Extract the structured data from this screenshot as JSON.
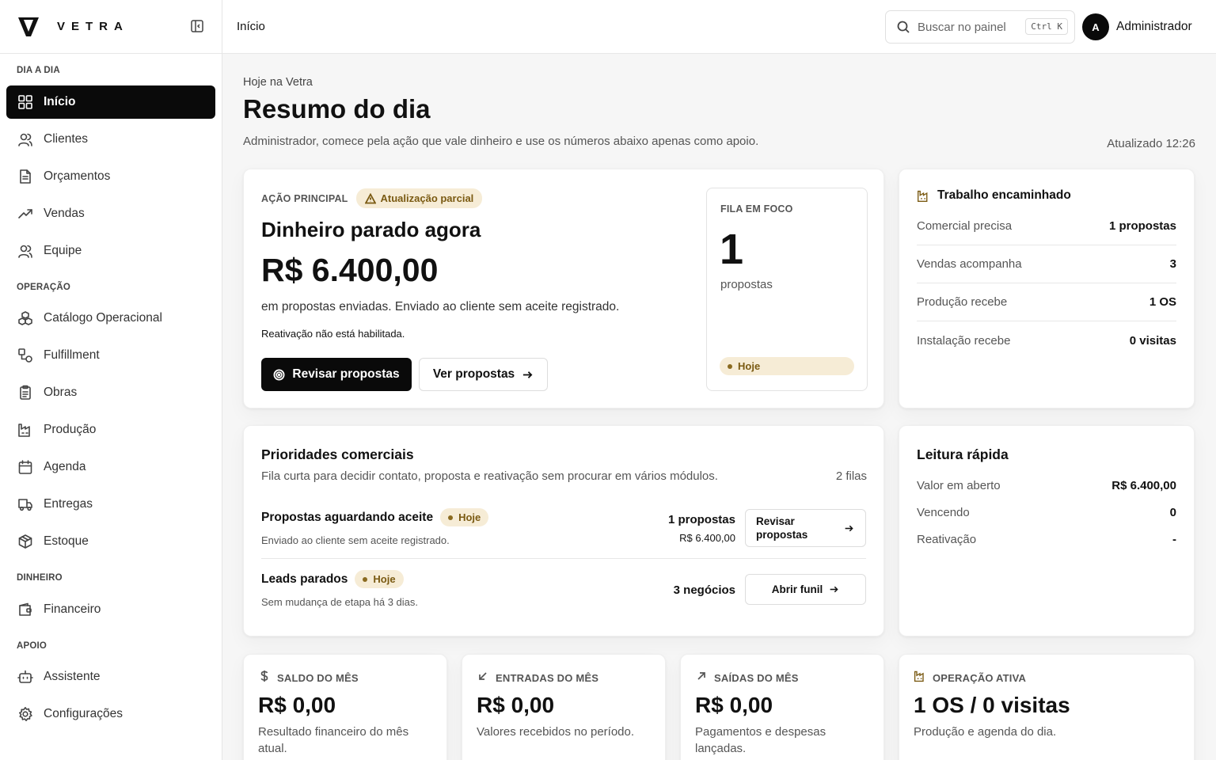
{
  "app": {
    "brand": "VETRA"
  },
  "sidebar": {
    "sections": [
      {
        "label": "DIA A DIA"
      },
      {
        "label": "OPERAÇÃO"
      },
      {
        "label": "DINHEIRO"
      },
      {
        "label": "APOIO"
      }
    ],
    "items": [
      {
        "label": "Início",
        "icon": "grid-icon",
        "active": true
      },
      {
        "label": "Clientes",
        "icon": "users-icon"
      },
      {
        "label": "Orçamentos",
        "icon": "document-icon"
      },
      {
        "label": "Vendas",
        "icon": "trending-up-icon"
      },
      {
        "label": "Equipe",
        "icon": "team-icon"
      },
      {
        "label": "Catálogo Operacional",
        "icon": "boxes-icon"
      },
      {
        "label": "Fulfillment",
        "icon": "shapes-icon"
      },
      {
        "label": "Obras",
        "icon": "clipboard-icon"
      },
      {
        "label": "Produção",
        "icon": "factory-icon"
      },
      {
        "label": "Agenda",
        "icon": "calendar-icon"
      },
      {
        "label": "Entregas",
        "icon": "truck-icon"
      },
      {
        "label": "Estoque",
        "icon": "package-icon"
      },
      {
        "label": "Financeiro",
        "icon": "wallet-icon"
      },
      {
        "label": "Assistente",
        "icon": "bot-icon"
      },
      {
        "label": "Configurações",
        "icon": "gear-icon"
      }
    ]
  },
  "header": {
    "title": "Início",
    "search_placeholder": "Buscar no painel",
    "shortcut": "Ctrl K",
    "avatar_initial": "A",
    "user_name": "Administrador"
  },
  "page": {
    "kicker": "Hoje na Vetra",
    "title": "Resumo do dia",
    "subtitle": "Administrador, comece pela ação que vale dinheiro e use os números abaixo apenas como apoio.",
    "updated": "Atualizado 12:26"
  },
  "action": {
    "caption": "AÇÃO PRINCIPAL",
    "badge": "Atualização parcial",
    "heading": "Dinheiro parado agora",
    "amount": "R$ 6.400,00",
    "description": "em propostas enviadas. Enviado ao cliente sem aceite registrado.",
    "note": "Reativação não está habilitada.",
    "primary_button": "Revisar propostas",
    "secondary_button": "Ver propostas",
    "focus": {
      "caption": "FILA EM FOCO",
      "number": "1",
      "unit": "propostas",
      "badge": "Hoje"
    }
  },
  "routed": {
    "title": "Trabalho encaminhado",
    "rows": [
      {
        "label": "Comercial precisa",
        "value": "1 propostas"
      },
      {
        "label": "Vendas acompanha",
        "value": "3"
      },
      {
        "label": "Produção recebe",
        "value": "1 OS"
      },
      {
        "label": "Instalação recebe",
        "value": "0 visitas"
      }
    ]
  },
  "priorities": {
    "title": "Prioridades comerciais",
    "subtitle": "Fila curta para decidir contato, proposta e reativação sem procurar em vários módulos.",
    "count": "2 filas",
    "items": [
      {
        "title": "Propostas aguardando aceite",
        "badge": "Hoje",
        "desc": "Enviado ao cliente sem aceite registrado.",
        "metric": "1 propostas",
        "metric_sub": "R$ 6.400,00",
        "button": "Revisar propostas"
      },
      {
        "title": "Leads parados",
        "badge": "Hoje",
        "desc": "Sem mudança de etapa há 3 dias.",
        "metric": "3 negócios",
        "button": "Abrir funil"
      }
    ]
  },
  "quick": {
    "title": "Leitura rápida",
    "rows": [
      {
        "label": "Valor em aberto",
        "value": "R$ 6.400,00"
      },
      {
        "label": "Vencendo",
        "value": "0"
      },
      {
        "label": "Reativação",
        "value": "-"
      }
    ]
  },
  "stats": [
    {
      "label": "SALDO DO MÊS",
      "icon": "dollar-icon",
      "value": "R$ 0,00",
      "desc": "Resultado financeiro do mês atual."
    },
    {
      "label": "ENTRADAS DO MÊS",
      "icon": "arrow-down-left-icon",
      "value": "R$ 0,00",
      "desc": "Valores recebidos no período."
    },
    {
      "label": "SAÍDAS DO MÊS",
      "icon": "arrow-up-right-icon",
      "value": "R$ 0,00",
      "desc": "Pagamentos e despesas lançadas."
    },
    {
      "label": "OPERAÇÃO ATIVA",
      "icon": "factory-icon",
      "value": "1 OS / 0 visitas",
      "desc": "Produção e agenda do dia."
    }
  ],
  "colors": {
    "accent_dark": "#0a0a0a",
    "badge_bg": "#f6ecd6",
    "badge_text": "#7a5a12"
  }
}
